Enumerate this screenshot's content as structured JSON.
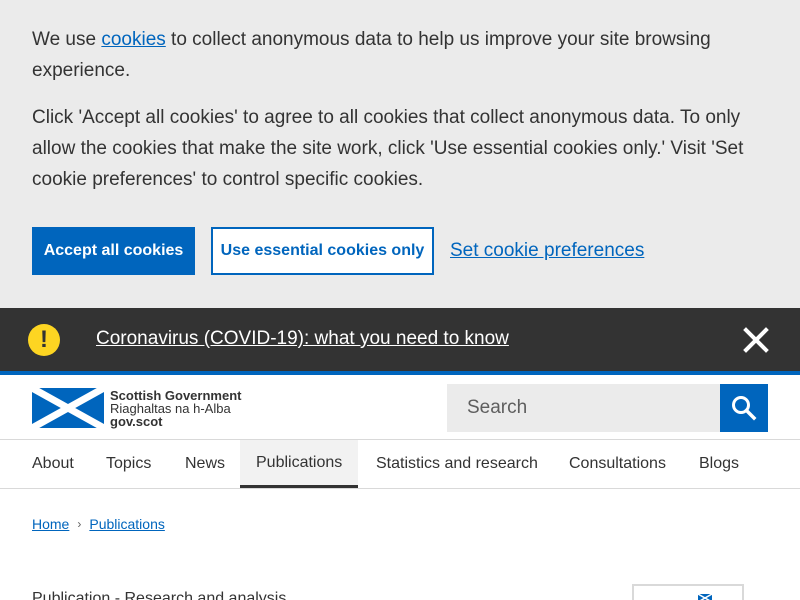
{
  "cookie_banner": {
    "text1_prefix": "We use ",
    "text1_link": "cookies",
    "text1_suffix": " to collect anonymous data to help us improve your site browsing experience.",
    "text2": "Click 'Accept all cookies' to agree to all cookies that collect anonymous data. To only allow the cookies that make the site work, click 'Use essential cookies only.' Visit 'Set cookie preferences' to control specific cookies.",
    "accept_label": "Accept all cookies",
    "essential_label": "Use essential cookies only",
    "preferences_label": "Set cookie preferences"
  },
  "alert": {
    "icon": "exclamation-icon",
    "glyph": "!",
    "link_text": "Coronavirus (COVID-19): what you need to know",
    "close_icon": "close-icon"
  },
  "header": {
    "logo": {
      "line1": "Scottish Government",
      "line2": "Riaghaltas na h-Alba",
      "line3": "gov.scot"
    },
    "search": {
      "placeholder": "Search",
      "value": "",
      "button_icon": "search-icon"
    }
  },
  "nav": {
    "items": [
      {
        "label": "About",
        "active": false
      },
      {
        "label": "Topics",
        "active": false
      },
      {
        "label": "News",
        "active": false
      },
      {
        "label": "Publications",
        "active": true
      },
      {
        "label": "Statistics and research",
        "active": false
      },
      {
        "label": "Consultations",
        "active": false
      },
      {
        "label": "Blogs",
        "active": false
      }
    ]
  },
  "breadcrumb": {
    "items": [
      "Home",
      "Publications"
    ]
  },
  "page": {
    "meta": "Publication - Research and analysis"
  },
  "colors": {
    "brand_blue": "#0065bd",
    "banner_bg": "#ebebeb",
    "alert_bg": "#333333",
    "alert_icon": "#fdd522"
  }
}
